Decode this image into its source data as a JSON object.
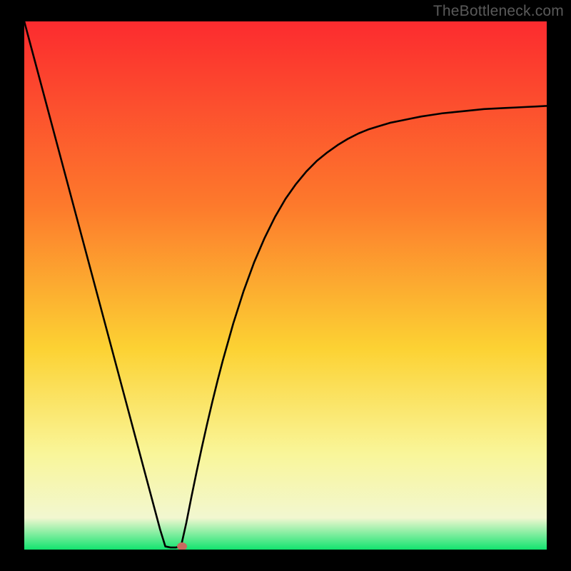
{
  "watermark": "TheBottleneck.com",
  "colors": {
    "gradient_top": "#fc2b2f",
    "gradient_mid_upper": "#fd7a2c",
    "gradient_mid": "#fcd233",
    "gradient_mid_lower": "#f9f69a",
    "gradient_lower": "#f2f7d0",
    "gradient_bottom": "#12e46f",
    "curve": "#000000",
    "marker_fill": "#c96a5f",
    "marker_stroke": "#b04f44",
    "frame_bg": "#000000"
  },
  "chart_data": {
    "type": "line",
    "title": "",
    "xlabel": "",
    "ylabel": "",
    "xlim": [
      0,
      100
    ],
    "ylim": [
      0,
      100
    ],
    "x": [
      0,
      1,
      2,
      3,
      4,
      5,
      6,
      7,
      8,
      9,
      10,
      11,
      12,
      13,
      14,
      15,
      16,
      17,
      18,
      19,
      20,
      21,
      22,
      23,
      24,
      25,
      26,
      27,
      28,
      29,
      30,
      31,
      32,
      33,
      34,
      35,
      36,
      37,
      38,
      40,
      42,
      44,
      46,
      48,
      50,
      52,
      54,
      56,
      58,
      60,
      62,
      64,
      66,
      68,
      70,
      72,
      74,
      76,
      78,
      80,
      82,
      84,
      86,
      88,
      90,
      92,
      94,
      96,
      98,
      100
    ],
    "values": [
      100.0,
      96.3,
      92.6,
      88.9,
      85.2,
      81.5,
      77.8,
      74.1,
      70.4,
      66.7,
      63.0,
      59.3,
      55.6,
      51.9,
      48.2,
      44.5,
      40.8,
      37.1,
      33.4,
      29.7,
      26.0,
      22.3,
      18.6,
      14.9,
      11.2,
      7.5,
      3.8,
      0.6,
      0.4,
      0.4,
      0.6,
      5.0,
      10.0,
      14.8,
      19.4,
      23.8,
      28.0,
      32.0,
      35.8,
      42.8,
      49.0,
      54.4,
      59.0,
      63.0,
      66.4,
      69.2,
      71.6,
      73.6,
      75.2,
      76.6,
      77.8,
      78.8,
      79.6,
      80.2,
      80.8,
      81.2,
      81.6,
      82.0,
      82.3,
      82.6,
      82.8,
      83.0,
      83.2,
      83.4,
      83.5,
      83.6,
      83.7,
      83.8,
      83.9,
      84.0
    ],
    "marker": {
      "x": 30.2,
      "y": 0.6
    }
  }
}
